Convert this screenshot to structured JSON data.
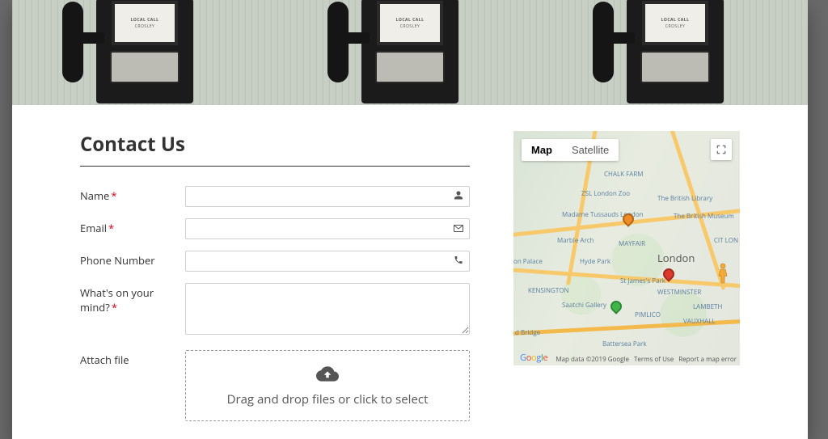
{
  "hero": {
    "plate_line1": "LOCAL CALL",
    "plate_line2": "CROSLEY"
  },
  "page": {
    "title": "Contact Us"
  },
  "form": {
    "name": {
      "label": "Name",
      "required": true,
      "value": "",
      "icon": "user-icon"
    },
    "email": {
      "label": "Email",
      "required": true,
      "value": "",
      "icon": "envelope-icon"
    },
    "phone": {
      "label": "Phone Number",
      "required": false,
      "value": "",
      "icon": "phone-icon"
    },
    "message": {
      "label": "What's on your mind?",
      "required": true,
      "value": ""
    },
    "attach": {
      "label": "Attach file",
      "dropzone_text": "Drag and drop files or click to select"
    }
  },
  "map": {
    "type_map": "Map",
    "type_satellite": "Satellite",
    "city": "London",
    "poi": {
      "chalk_farm": "CHALK FARM",
      "zoo": "ZSL London Zoo",
      "british_library": "The British Library",
      "tussauds": "Madame Tussauds London",
      "british_museum": "The British Museum",
      "marble_arch": "Marble Arch",
      "mayfair": "MAYFAIR",
      "hyde_park": "Hyde Park",
      "palace": "on Palace",
      "st_james": "St James's Park",
      "kensington": "KENSINGTON",
      "westminster": "WESTMINSTER",
      "saatchi": "Saatchi Gallery",
      "pimlico": "PIMLICO",
      "lambeth": "LAMBETH",
      "vauxhall": "VAUXHALL",
      "battersea": "Battersea Park",
      "bridge": "d Bridge",
      "cit": "CIT LON"
    },
    "attribution": "Map data ©2019 Google",
    "terms": "Terms of Use",
    "report": "Report a map error",
    "zoom_in": "+",
    "zoom_out": "−"
  }
}
